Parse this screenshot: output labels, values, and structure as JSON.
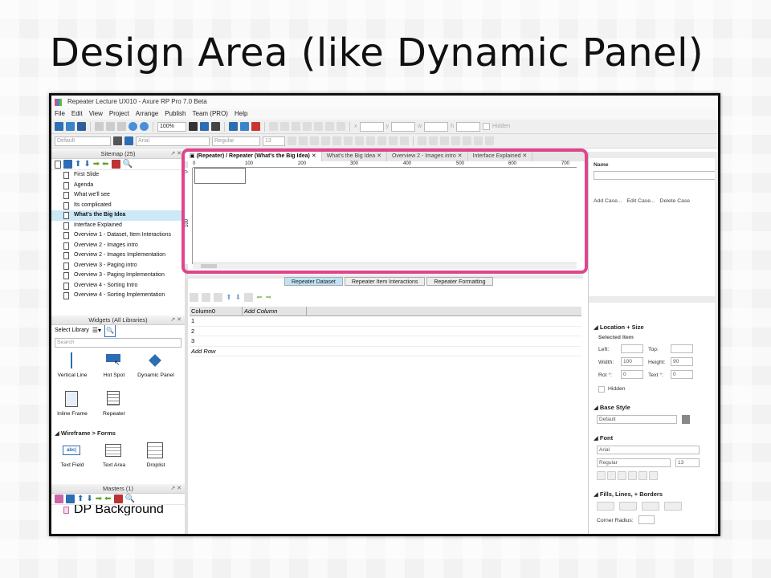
{
  "slide": {
    "title": "Design Area (like Dynamic Panel)"
  },
  "app": {
    "window_title": "Repeater Lecture UXI10 - Axure RP Pro 7.0 Beta",
    "menu": [
      "File",
      "Edit",
      "View",
      "Project",
      "Arrange",
      "Publish",
      "Team (PRO)",
      "Help"
    ],
    "zoom": "100%",
    "style_default": "Default",
    "font_family": "Arial",
    "font_weight": "Regular",
    "font_size": "13",
    "hidden_label": "Hidden",
    "x_label": "x",
    "y_label": "y",
    "w_label": "w",
    "h_label": "h"
  },
  "sitemap": {
    "header": "Sitemap (25)",
    "pages": [
      "First Slide",
      "Agenda",
      "What we'll see",
      "Its complicated",
      "What's the Big Idea",
      "Interface Explained",
      "Overview 1 - Dataset, Item Interactions",
      "Overview 2 - Images intro",
      "Overview 2 - Images Implementation",
      "Overview 3 - Paging intro",
      "Overview 3 - Paging Implementation",
      "Overview 4 - Sorting Intro",
      "Overview 4 - Sorting Implementation"
    ],
    "selected_index": 4
  },
  "widgets": {
    "header": "Widgets (All Libraries)",
    "select_library": "Select Library",
    "search_placeholder": "Search",
    "items": [
      "Vertical Line",
      "Hot Spot",
      "Dynamic Panel",
      "Inline Frame",
      "Repeater"
    ],
    "forms_section": "Wireframe > Forms",
    "form_items": [
      "Text Field",
      "Text Area",
      "Droplist"
    ],
    "text_field_sample": "abc|"
  },
  "masters": {
    "header": "Masters (1)",
    "items": [
      "DP Background"
    ]
  },
  "tabs": [
    "(Repeater) / Repeater (What's the Big Idea)",
    "What's the Big Idea",
    "Overview 2 - Images intro",
    "Interface Explained"
  ],
  "ruler": {
    "h": [
      "0",
      "100",
      "200",
      "300",
      "400",
      "500",
      "600",
      "700"
    ],
    "v": [
      "0",
      "100"
    ]
  },
  "dataset": {
    "tabs": [
      "Repeater Dataset",
      "Repeater Item Interactions",
      "Repeater Formatting"
    ],
    "columns": [
      "Column0",
      "Add Column"
    ],
    "rows": [
      "1",
      "2",
      "3"
    ],
    "add_row": "Add Row"
  },
  "inspector": {
    "name_label": "Name",
    "cases": [
      "Add Case...",
      "Edit Case...",
      "Delete Case"
    ],
    "location_size": "Location + Size",
    "selected_item": "Selected Item",
    "left": "Left:",
    "top": "Top:",
    "width": "Width:",
    "width_value": "100",
    "height": "Height:",
    "height_value": "90",
    "rot": "Rot °:",
    "rot_value": "0",
    "text_rot": "Text °:",
    "text_rot_value": "0",
    "hidden": "Hidden",
    "base_style": "Base Style",
    "base_style_value": "Default",
    "font": "Font",
    "font_family": "Arial",
    "font_weight": "Regular",
    "font_size": "13",
    "fills": "Fills, Lines, + Borders",
    "corner_radius": "Corner Radius:"
  },
  "colors": {
    "highlight": "#e0458c",
    "selected_row": "#cde8f6",
    "active_tab": "#bfe3f5"
  }
}
